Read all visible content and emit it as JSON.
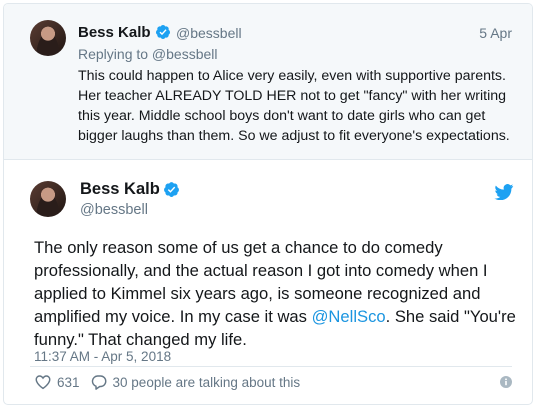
{
  "colors": {
    "link": "#1b95e0",
    "muted": "#657786",
    "verified": "#1da1f2",
    "border": "#e1e8ed"
  },
  "parent_tweet": {
    "author_name": "Bess Kalb",
    "handle": "@bessbell",
    "date": "5 Apr",
    "replying_to": "Replying to @bessbell",
    "text_lines": [
      "This could happen to Alice very easily, even with supportive parents.",
      "Her teacher ALREADY TOLD HER not to get \"fancy\" with her writing",
      "this year. Middle school boys don't want to date girls who can get",
      "bigger laughs than them. So we adjust to fit everyone's expectations."
    ]
  },
  "main_tweet": {
    "author_name": "Bess Kalb",
    "handle": "@bessbell",
    "text": {
      "line1": "The only reason some of us get a chance to do comedy",
      "line2": "professionally, and the actual reason I got into comedy when I",
      "line3": "applied to Kimmel six years ago, is someone recognized and",
      "line4_before": "amplified my voice. In my case it was ",
      "line4_mention": "@NellSco",
      "line4_after": ". She said \"You're",
      "line5": "funny.\" That changed my life."
    },
    "timestamp": "11:37 AM - Apr 5, 2018",
    "likes": "631",
    "conversation": "30 people are talking about this"
  },
  "icons": [
    "verified-icon",
    "twitter-bird-icon",
    "heart-icon",
    "reply-bubble-icon",
    "info-icon"
  ]
}
